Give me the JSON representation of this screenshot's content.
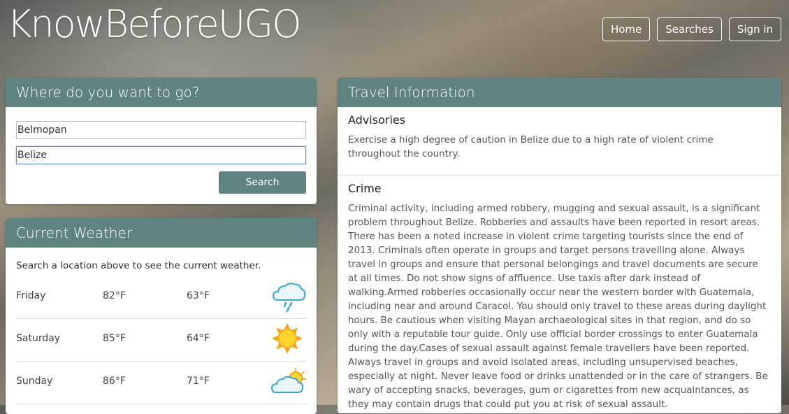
{
  "brand": "KnowBeforeUGO",
  "nav": [
    "Home",
    "Searches",
    "Sign in"
  ],
  "search_panel": {
    "title": "Where do you want to go?",
    "city_value": "Belmopan",
    "country_value": "Belize",
    "button": "Search"
  },
  "weather_panel": {
    "title": "Current Weather",
    "hint": "Search a location above to see the current weather.",
    "rows": [
      {
        "day": "Friday",
        "high": "82°F",
        "low": "63°F",
        "icon": "rain-cloud-icon"
      },
      {
        "day": "Saturday",
        "high": "85°F",
        "low": "64°F",
        "icon": "sun-icon"
      },
      {
        "day": "Sunday",
        "high": "86°F",
        "low": "71°F",
        "icon": "partly-cloudy-icon"
      }
    ]
  },
  "info_panel": {
    "title": "Travel Information",
    "advisories_title": "Advisories",
    "advisories_text": "Exercise a high degree of caution in Belize due to a high rate of violent crime throughout the country.",
    "crime_title": "Crime",
    "crime_text": "Criminal activity, including armed robbery, mugging and sexual assault, is a significant problem throughout Belize. Robberies and assaults have been reported in resort areas. There has been a noted increase in violent crime targeting tourists since the end of 2013. Criminals often operate in groups and target persons travelling alone. Always travel in groups and ensure that personal belongings and travel documents are secure at all times. Do not show signs of affluence. Use taxis after dark instead of walking.Armed robberies occasionally occur near the western border with Guatemala, including near and around Caracol. You should only travel to these areas during daylight hours. Be cautious when visiting Mayan archaeological sites in that region, and do so only with a reputable tour guide. Only use official border crossings to enter Guatemala during the day.Cases of sexual assault against female travellers have been reported. Always travel in groups and avoid isolated areas, including unsupervised beaches, especially at night. Never leave food or drinks unattended or in the care of strangers. Be wary of accepting snacks, beverages, gum or cigarettes from new acquaintances, as they may contain drugs that could put you at risk of sexual assault."
  },
  "colors": {
    "accent": "#5e8380",
    "focus": "#5b8fd6"
  }
}
